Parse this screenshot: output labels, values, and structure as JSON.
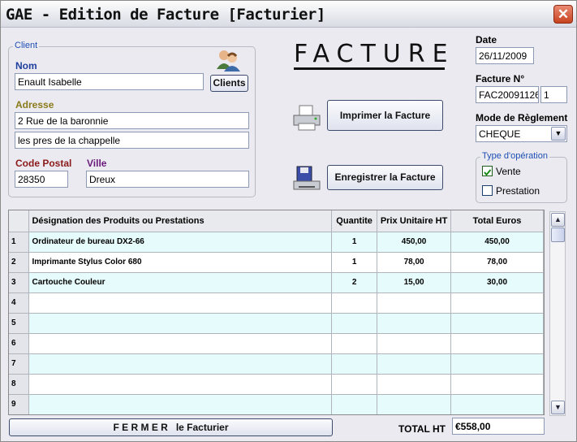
{
  "window": {
    "title": "GAE - Edition de Facture [Facturier]",
    "close": "✕"
  },
  "client": {
    "group_label": "Client",
    "nom_label": "Nom",
    "nom_value": "Enault Isabelle",
    "clients_button": "Clients",
    "adresse_label": "Adresse",
    "adresse1": "2 Rue de la baronnie",
    "adresse2": "les pres de la chappelle",
    "cp_label": "Code Postal",
    "cp_value": "28350",
    "ville_label": "Ville",
    "ville_value": "Dreux"
  },
  "heading": "FACTURE",
  "actions": {
    "print_label": "Imprimer la Facture",
    "save_label": "Enregistrer la Facture"
  },
  "date": {
    "label": "Date",
    "value": "26/11/2009"
  },
  "facture": {
    "label": "Facture N°",
    "number": "FAC20091126",
    "index": "1"
  },
  "reglement": {
    "label": "Mode de Règlement",
    "value": "CHEQUE"
  },
  "operation": {
    "group_label": "Type d'opération",
    "vente_label": "Vente",
    "vente_checked": true,
    "prestation_label": "Prestation",
    "prestation_checked": false
  },
  "table": {
    "headers": [
      "Désignation des Produits ou Prestations",
      "Quantite",
      "Prix Unitaire HT",
      "Total Euros"
    ],
    "rows": [
      {
        "n": "1",
        "designation": "Ordinateur de bureau DX2-66",
        "qty": "1",
        "pu": "450,00",
        "total": "450,00"
      },
      {
        "n": "2",
        "designation": "Imprimante Stylus Color 680",
        "qty": "1",
        "pu": "78,00",
        "total": "78,00"
      },
      {
        "n": "3",
        "designation": "Cartouche Couleur",
        "qty": "2",
        "pu": "15,00",
        "total": "30,00"
      },
      {
        "n": "4",
        "designation": "",
        "qty": "",
        "pu": "",
        "total": ""
      },
      {
        "n": "5",
        "designation": "",
        "qty": "",
        "pu": "",
        "total": ""
      },
      {
        "n": "6",
        "designation": "",
        "qty": "",
        "pu": "",
        "total": ""
      },
      {
        "n": "7",
        "designation": "",
        "qty": "",
        "pu": "",
        "total": ""
      },
      {
        "n": "8",
        "designation": "",
        "qty": "",
        "pu": "",
        "total": ""
      },
      {
        "n": "9",
        "designation": "",
        "qty": "",
        "pu": "",
        "total": ""
      }
    ]
  },
  "footer": {
    "close_label": "F E R M E R   le Facturier",
    "total_label": "TOTAL HT",
    "total_value": "€558,00"
  },
  "colors": {
    "accent": "#1e4fb5",
    "nom_label": "#1e3f9e",
    "adresse_label": "#8a7a1a",
    "cp_label": "#8b1a1a",
    "ville_label": "#6a1a7a"
  }
}
